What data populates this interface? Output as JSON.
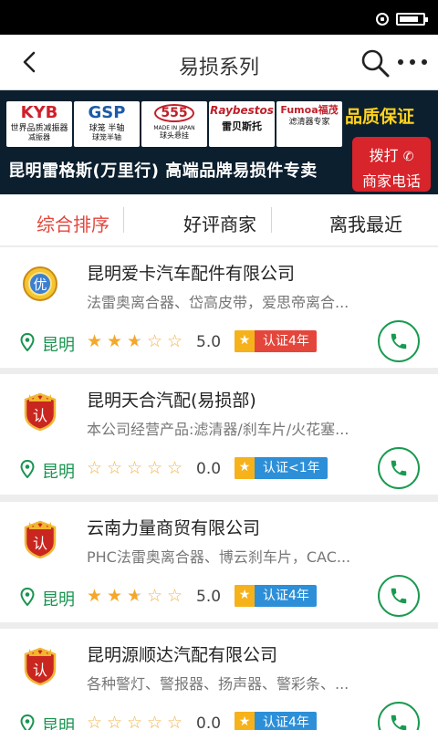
{
  "header": {
    "title": "易损系列"
  },
  "banner": {
    "brands": [
      {
        "logo": "KYB",
        "sub": "世界品质减振器",
        "sub2": "减振器",
        "logo_color": "#d0202a"
      },
      {
        "logo": "GSP",
        "sub": "球笼 半轴",
        "sub2": "球笼半轴",
        "logo_color": "#1d5aa8"
      },
      {
        "logo": "555",
        "sub": "MADE IN JAPAN",
        "sub2": "球头悬挂",
        "logo_color": "#c0202a"
      },
      {
        "logo": "Raybestos",
        "sub": "",
        "sub2": "雷贝斯托",
        "logo_color": "#c0202a"
      },
      {
        "logo": "Fumoa福茂",
        "sub": "滤清器专家",
        "sub2": "",
        "logo_color": "#c0202a"
      }
    ],
    "quality": "品质保证",
    "slogan": "昆明雷格斯(万里行) 高端品牌易损件专卖",
    "call_line1": "拨打",
    "call_line2": "商家电话"
  },
  "tabs": [
    {
      "label": "综合排序",
      "active": true
    },
    {
      "label": "好评商家",
      "active": false
    },
    {
      "label": "离我最近",
      "active": false
    }
  ],
  "merchants": [
    {
      "badge": "优",
      "name": "昆明爱卡汽车配件有限公司",
      "desc": "法雷奥离合器、岱高皮带，爱思帝离合...",
      "location": "昆明",
      "rating": 2.5,
      "score": "5.0",
      "cert": "认证4年",
      "cert_color": "#e4463b"
    },
    {
      "badge": "认",
      "name": "昆明天合汽配(易损部)",
      "desc": "本公司经营产品:滤清器/刹车片/火花塞...",
      "location": "昆明",
      "rating": 0,
      "score": "0.0",
      "cert": "认证<1年",
      "cert_color": "#2d8fd8"
    },
    {
      "badge": "认",
      "name": "云南力量商贸有限公司",
      "desc": "PHC法雷奥离合器、博云刹车片，CAC...",
      "location": "昆明",
      "rating": 2.5,
      "score": "5.0",
      "cert": "认证4年",
      "cert_color": "#2d8fd8"
    },
    {
      "badge": "认",
      "name": "昆明源顺达汽配有限公司",
      "desc": "各种警灯、警报器、扬声器、警彩条、...",
      "location": "昆明",
      "rating": 0,
      "score": "0.0",
      "cert": "认证4年",
      "cert_color": "#2d8fd8"
    }
  ]
}
